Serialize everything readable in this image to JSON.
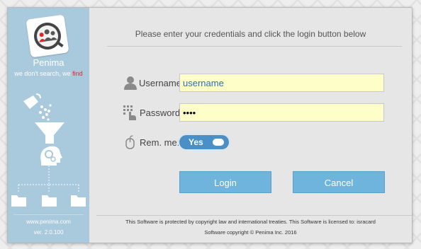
{
  "sidebar": {
    "brand": "Penima",
    "tagline_prefix": "we don't search, we ",
    "tagline_highlight": "find",
    "website": "www.penima.com",
    "version": "ver. 2.0.100"
  },
  "form": {
    "instructions": "Please enter your credentials and click the login button below",
    "username_label": "Username:",
    "username_value": "username",
    "password_label": "Password:",
    "password_value": "••••",
    "remember_label": "Rem. me:",
    "remember_state": "Yes"
  },
  "buttons": {
    "login": "Login",
    "cancel": "Cancel"
  },
  "footer": {
    "line1": "This Software is protected by copyright law and international treaties. This Software is licensed to: isracard",
    "line2": "Software copyright © Penima Inc. 2016"
  },
  "colors": {
    "sidebar_bg": "#a9c9dc",
    "input_bg": "#fefec8",
    "button_bg": "#6fb4dc",
    "toggle_bg": "#4a8fc6",
    "tagline_accent": "#d9282f"
  }
}
